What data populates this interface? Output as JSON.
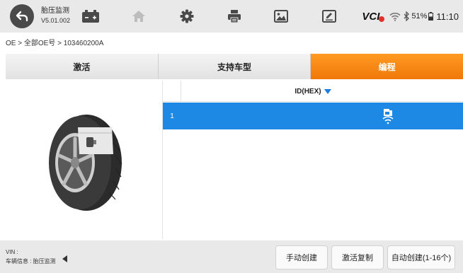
{
  "header": {
    "title": "胎压监测",
    "version": "V5.01.002",
    "tools": [
      {
        "name": "home-icon"
      },
      {
        "name": "gear-icon"
      },
      {
        "name": "printer-icon"
      },
      {
        "name": "image-icon"
      },
      {
        "name": "edit-icon"
      }
    ],
    "status": {
      "vci": "VCI",
      "battery_percent": "51%",
      "time": "11:10"
    }
  },
  "breadcrumb": "OE > 全部OE号 > 103460200A",
  "tabs": [
    {
      "label": "激活",
      "active": false
    },
    {
      "label": "支持车型",
      "active": false
    },
    {
      "label": "编程",
      "active": true
    }
  ],
  "table": {
    "columns": [
      "ID(HEX)"
    ],
    "rows": [
      {
        "index": "1",
        "id": "",
        "icon": "obd-wireless-icon",
        "selected": true
      }
    ]
  },
  "footer": {
    "vin_label": "VIN :",
    "vehicle_info": "车辆信息 : 胎压监测",
    "buttons": [
      "手动创建",
      "激活复制",
      "自动创建(1-16个)"
    ]
  },
  "colors": {
    "accent_orange": "#f7890f",
    "selection_blue": "#1e88e5",
    "vci_indicator": "#e0312a"
  }
}
